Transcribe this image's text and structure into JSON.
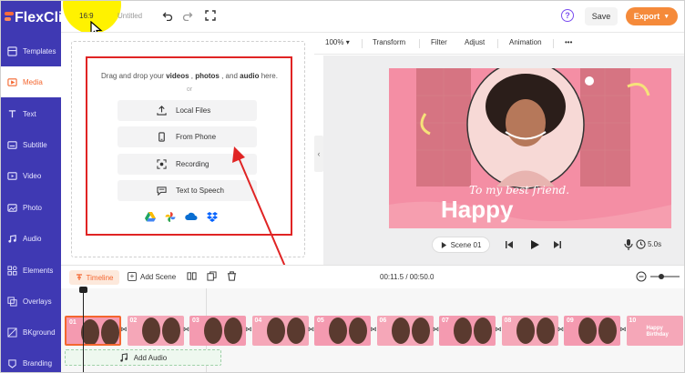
{
  "app": {
    "brand": "FlexClip",
    "aspect_ratio": "16:9",
    "project_title": "Untitled"
  },
  "sidebar": {
    "items": [
      {
        "label": "Templates",
        "icon": "templates-icon"
      },
      {
        "label": "Media",
        "icon": "media-icon",
        "active": true
      },
      {
        "label": "Text",
        "icon": "text-icon"
      },
      {
        "label": "Subtitle",
        "icon": "subtitle-icon"
      },
      {
        "label": "Video",
        "icon": "video-icon"
      },
      {
        "label": "Photo",
        "icon": "photo-icon"
      },
      {
        "label": "Audio",
        "icon": "audio-icon"
      },
      {
        "label": "Elements",
        "icon": "elements-icon"
      },
      {
        "label": "Overlays",
        "icon": "overlays-icon"
      },
      {
        "label": "BKground",
        "icon": "background-icon"
      },
      {
        "label": "Branding",
        "icon": "branding-icon"
      }
    ]
  },
  "header": {
    "save_label": "Save",
    "export_label": "Export",
    "help_label": "?"
  },
  "media_panel": {
    "drag_prefix": "Drag and drop your",
    "kw_videos": "videos",
    "kw_photos": "photos",
    "kw_audio": "audio",
    "drag_suffix": "here.",
    "or_label": "or",
    "buttons": [
      "Local Files",
      "From Phone",
      "Recording",
      "Text to Speech"
    ],
    "cloud_sources": [
      "google-drive-icon",
      "google-photos-icon",
      "onedrive-icon",
      "dropbox-icon"
    ]
  },
  "toolbar": {
    "zoom": "100%",
    "items": [
      "Transform",
      "Filter",
      "Adjust",
      "Animation"
    ],
    "more": "•••"
  },
  "preview": {
    "script_text": "To my best friend.",
    "headline": "Happy",
    "scene_label": "Scene 01",
    "duration": "5.0s"
  },
  "timeline": {
    "label": "Timeline",
    "add_scene": "Add Scene",
    "time_readout": "00:11.5 / 00:50.0",
    "clip_numbers": [
      "01",
      "02",
      "03",
      "04",
      "05",
      "06",
      "07",
      "08",
      "09",
      "10"
    ],
    "last_clip_text": "Happy Birthday",
    "add_audio": "Add Audio"
  },
  "colors": {
    "sidebar": "#3f39b3",
    "accent": "#f4662f",
    "export": "#f58a3a",
    "highlight": "#fff200",
    "annotation": "#e02424",
    "clip": "#f49ab0"
  }
}
